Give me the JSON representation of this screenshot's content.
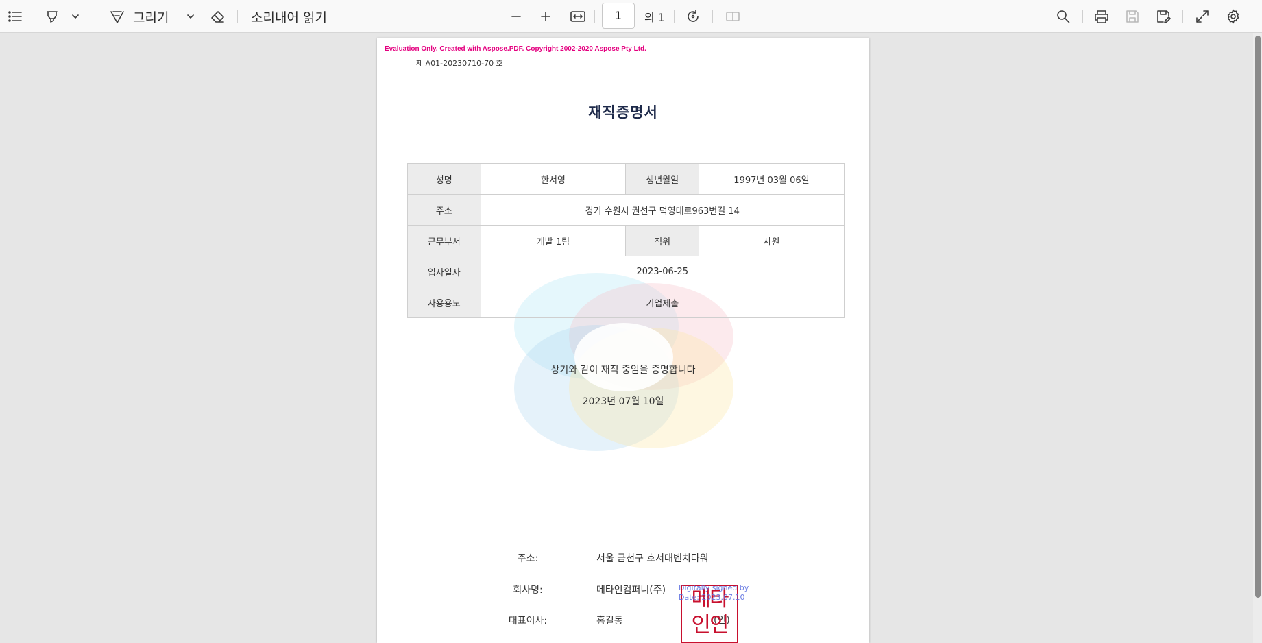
{
  "toolbar": {
    "draw_label": "그리기",
    "read_aloud_label": "소리내어 읽기",
    "page_number": "1",
    "page_total": "의 1"
  },
  "document": {
    "eval_notice": "Evaluation Only. Created with Aspose.PDF. Copyright 2002-2020 Aspose Pty Ltd.",
    "doc_number": "제 A01-20230710-70 호",
    "title": "재직증명서",
    "table": {
      "name_label": "성명",
      "name": "한서영",
      "birth_label": "생년월일",
      "birth": "1997년 03월 06일",
      "address_label": "주소",
      "address": "경기 수원시 권선구 덕영대로963번길 14",
      "dept_label": "근무부서",
      "dept": "개발 1팀",
      "position_label": "직위",
      "position": "사원",
      "joined_label": "입사일자",
      "joined": "2023-06-25",
      "purpose_label": "사용용도",
      "purpose": "기업제출"
    },
    "statement": "상기와 같이 재직 중임을 증명합니다",
    "issue_date": "2023년 07월 10일",
    "company": {
      "address_label": "주소:",
      "address": "서울 금천구 호서대벤치타워",
      "name_label": "회사명:",
      "name": "메타인컴퍼니(주)",
      "ceo_label": "대표이사:",
      "ceo": "홍길동",
      "seal_mark": "(인)"
    },
    "stamp_text": [
      "메타",
      "인인"
    ],
    "signature_note": [
      "Digitally signed by",
      "Date: 2023.07.10"
    ]
  }
}
